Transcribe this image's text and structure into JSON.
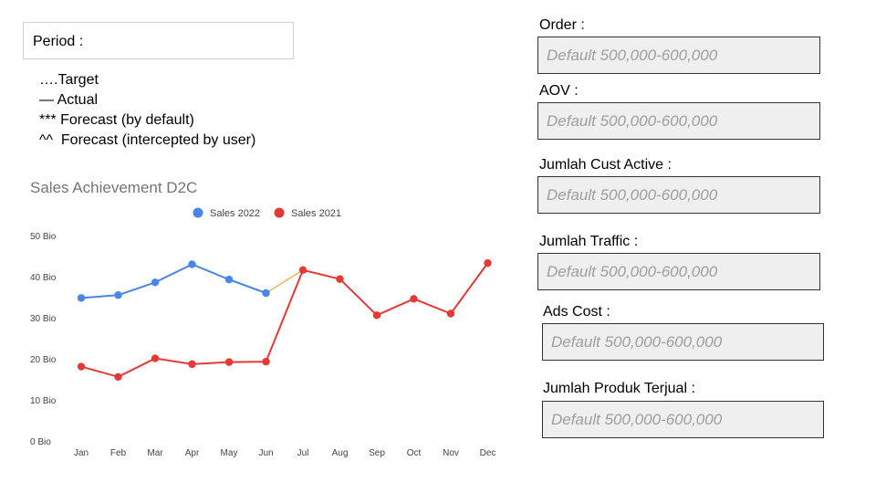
{
  "period": {
    "label": "Period :"
  },
  "legend_notes": [
    "….Target",
    "— Actual",
    "*** Forecast (by default)",
    "^^  Forecast (intercepted by user)"
  ],
  "fields": [
    {
      "label": "Order :",
      "placeholder": "Default 500,000-600,000"
    },
    {
      "label": "AOV :",
      "placeholder": "Default 500,000-600,000"
    },
    {
      "label": "Jumlah Cust Active :",
      "placeholder": "Default 500,000-600,000"
    },
    {
      "label": "Jumlah Traffic :",
      "placeholder": "Default 500,000-600,000"
    },
    {
      "label": "Ads Cost :",
      "placeholder": "Default 500,000-600,000"
    },
    {
      "label": "Jumlah Produk Terjual :",
      "placeholder": "Default 500,000-600,000"
    }
  ],
  "colors": {
    "sales_2022": "#4a86e8",
    "sales_2021": "#e53935",
    "connector": "#f4a43a",
    "title": "#757575",
    "axis_text": "#444444"
  },
  "chart_data": {
    "type": "line",
    "title": "Sales Achievement D2C",
    "categories": [
      "Jan",
      "Feb",
      "Mar",
      "Apr",
      "May",
      "Jun",
      "Jul",
      "Aug",
      "Sep",
      "Oct",
      "Nov",
      "Dec"
    ],
    "yticks": [
      "0 Bio",
      "10 Bio",
      "20 Bio",
      "30 Bio",
      "40 Bio",
      "50 Bio"
    ],
    "ylim": [
      0,
      50
    ],
    "grid": false,
    "legend_position": "top",
    "series": [
      {
        "name": "Sales 2022",
        "values": [
          34.8,
          35.5,
          38.6,
          43.0,
          39.3,
          36.0,
          null,
          null,
          null,
          null,
          null,
          null
        ]
      },
      {
        "name": "Sales 2021",
        "values": [
          18.1,
          15.6,
          20.1,
          18.7,
          19.2,
          19.3,
          41.6,
          39.4,
          30.6,
          34.6,
          31.0,
          43.3
        ]
      }
    ],
    "connector": {
      "from": [
        "Jun",
        36.0
      ],
      "to": [
        "Jul",
        41.6
      ]
    }
  }
}
